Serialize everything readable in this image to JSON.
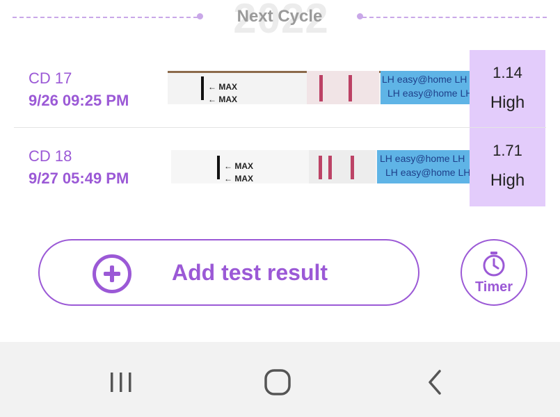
{
  "header": {
    "title": "Next Cycle",
    "year_watermark": "2022"
  },
  "tests": [
    {
      "cycle_day": "CD 17",
      "datetime": "9/26   09:25 PM",
      "strip": {
        "max_label_1": "MAX",
        "max_label_2": "MAX",
        "brand_text": "LH   easy@home   LH"
      },
      "value": "1.14",
      "level": "High"
    },
    {
      "cycle_day": "CD 18",
      "datetime": "9/27   05:49 PM",
      "strip": {
        "max_label_1": "MAX",
        "max_label_2": "MAX",
        "brand_text": "LH   easy@home   LH"
      },
      "value": "1.71",
      "level": "High"
    }
  ],
  "actions": {
    "add_label": "Add test result",
    "timer_label": "Timer"
  },
  "navigation": {
    "recent_icon": "recent-apps-icon",
    "home_icon": "home-icon",
    "back_icon": "back-icon"
  },
  "colors": {
    "accent": "#9b59d6",
    "result_bg": "#e3ccfb",
    "strip_blue": "#5fb4e6",
    "test_line": "#b3244d"
  }
}
